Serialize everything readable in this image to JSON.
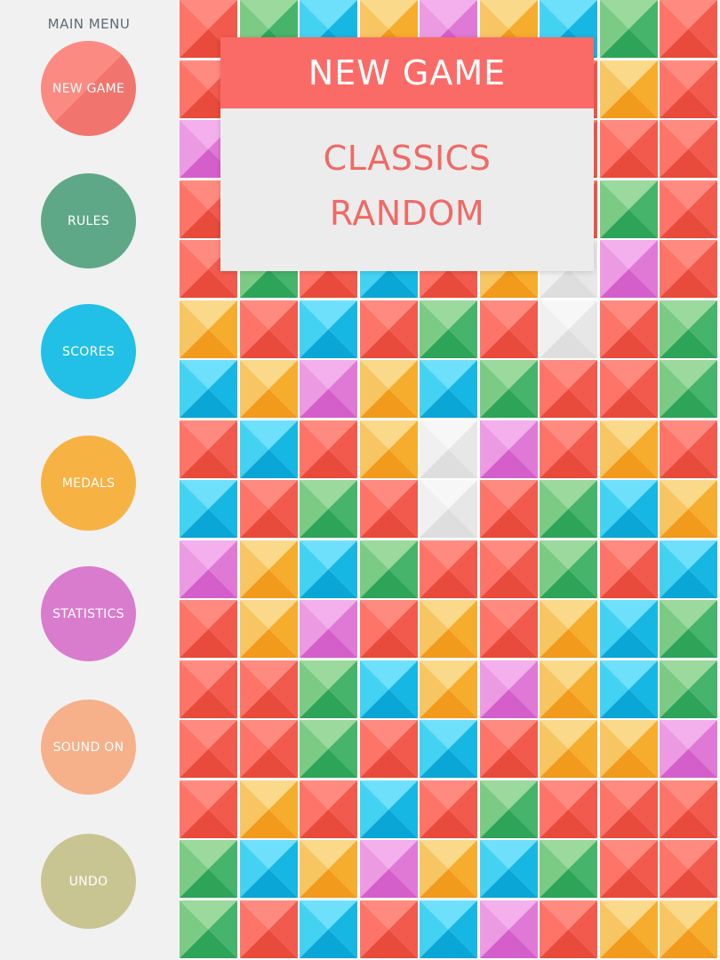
{
  "sidebar": {
    "title": "MAIN MENU",
    "buttons": [
      {
        "key": "new-game",
        "label": "NEW GAME",
        "color": "#fb7a72"
      },
      {
        "key": "rules",
        "label": "RULES",
        "color": "#5fa887"
      },
      {
        "key": "scores",
        "label": "SCORES",
        "color": "#22c0e6"
      },
      {
        "key": "medals",
        "label": "MEDALS",
        "color": "#f7b244"
      },
      {
        "key": "statistics",
        "label": "STATISTICS",
        "color": "#d97ccd"
      },
      {
        "key": "sound-on",
        "label": "SOUND ON",
        "color": "#f6b08a"
      },
      {
        "key": "undo",
        "label": "UNDO",
        "color": "#c9c592"
      }
    ]
  },
  "popup": {
    "title": "NEW GAME",
    "options": [
      "CLASSICS",
      "RANDOM"
    ]
  },
  "palette": {
    "R": {
      "top": "#ff8a80",
      "left": "#ff7468",
      "right": "#f25a4d",
      "bottom": "#e84b3c"
    },
    "G": {
      "top": "#9bd99c",
      "left": "#7bcb85",
      "right": "#46b46a",
      "bottom": "#2ea458"
    },
    "B": {
      "top": "#6fe0fb",
      "left": "#44d2f2",
      "right": "#17b7e3",
      "bottom": "#0aa6d6"
    },
    "O": {
      "top": "#fad98b",
      "left": "#f8c563",
      "right": "#f6ad2d",
      "bottom": "#f19a1c"
    },
    "P": {
      "top": "#f3b0ec",
      "left": "#ec9be3",
      "right": "#e079d6",
      "bottom": "#d45fcb"
    },
    "W": {
      "top": "#f7f7f7",
      "left": "#f0f0f0",
      "right": "#e7e7e7",
      "bottom": "#dedede"
    }
  },
  "board": {
    "rows": [
      "RGBOPOBGR",
      "RBRRRRROR",
      "PRRRRRRRR",
      "RGRRRRRGR",
      "RGRBROWPR",
      "ORBRGRWRG",
      "BOPOBGRRG",
      "RBROWPROR",
      "BRGRWRGBO",
      "POBGRRGRB",
      "ROPROROBG",
      "RRGBOPOBG",
      "RRGRBROOP",
      "RORBRGRRR",
      "GBOPOBGRR",
      "GRBRBPROO"
    ]
  }
}
